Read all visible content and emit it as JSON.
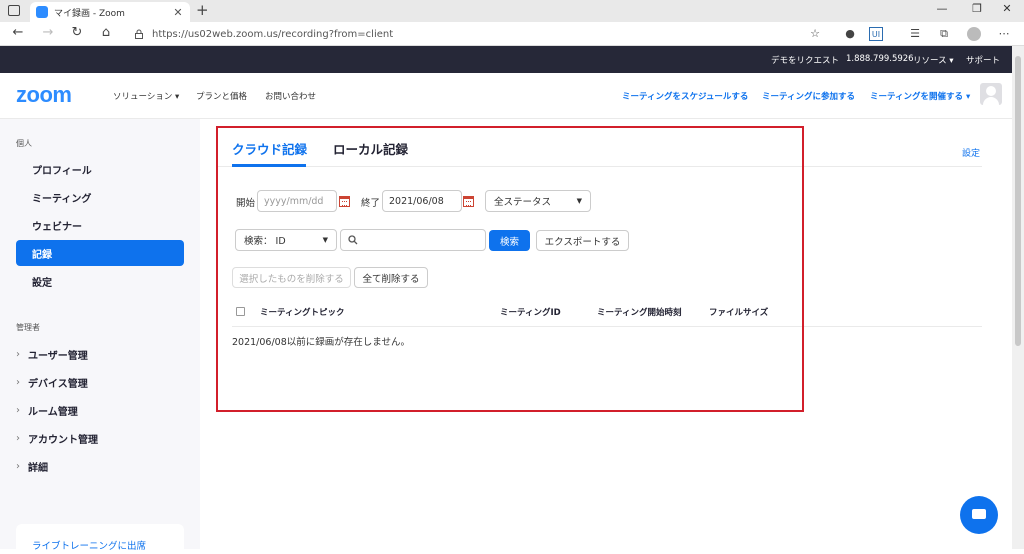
{
  "browser": {
    "tab_title": "マイ録画 - Zoom",
    "tab_close": "✕",
    "new_tab": "+",
    "url": "https://us02web.zoom.us/recording?from=client",
    "min": "—",
    "max": "❐",
    "close": "✕"
  },
  "topbar": {
    "demo": "デモをリクエスト",
    "phone": "1.888.799.5926",
    "resources": "リソース ▾",
    "support": "サポート"
  },
  "header": {
    "logo": "zoom",
    "solutions": "ソリューション ▾",
    "plans": "プランと価格",
    "contact": "お問い合わせ",
    "schedule": "ミーティングをスケジュールする",
    "join": "ミーティングに参加する",
    "host": "ミーティングを開催する ▾"
  },
  "sidebar": {
    "personal_title": "個人",
    "items": [
      "プロフィール",
      "ミーティング",
      "ウェビナー",
      "記録",
      "設定"
    ],
    "admin_title": "管理者",
    "admin_items": [
      "ユーザー管理",
      "デバイス管理",
      "ルーム管理",
      "アカウント管理",
      "詳細"
    ],
    "promo": "ライブトレーニングに出席"
  },
  "main": {
    "tab_cloud": "クラウド記録",
    "tab_local": "ローカル記録",
    "settings": "設定",
    "start_label": "開始",
    "start_placeholder": "yyyy/mm/dd",
    "end_label": "終了",
    "end_value": "2021/06/08",
    "status_value": "全ステータス",
    "search_type": "検索： ID",
    "search_value": "",
    "search_button": "検索",
    "export_button": "エクスポートする",
    "delete_selected": "選択したものを削除する",
    "delete_all": "全て削除する",
    "columns": [
      "ミーティングトピック",
      "ミーティングID",
      "ミーティング開始時刻",
      "ファイルサイズ"
    ],
    "empty_message": "2021/06/08以前に録画が存在しません。"
  }
}
